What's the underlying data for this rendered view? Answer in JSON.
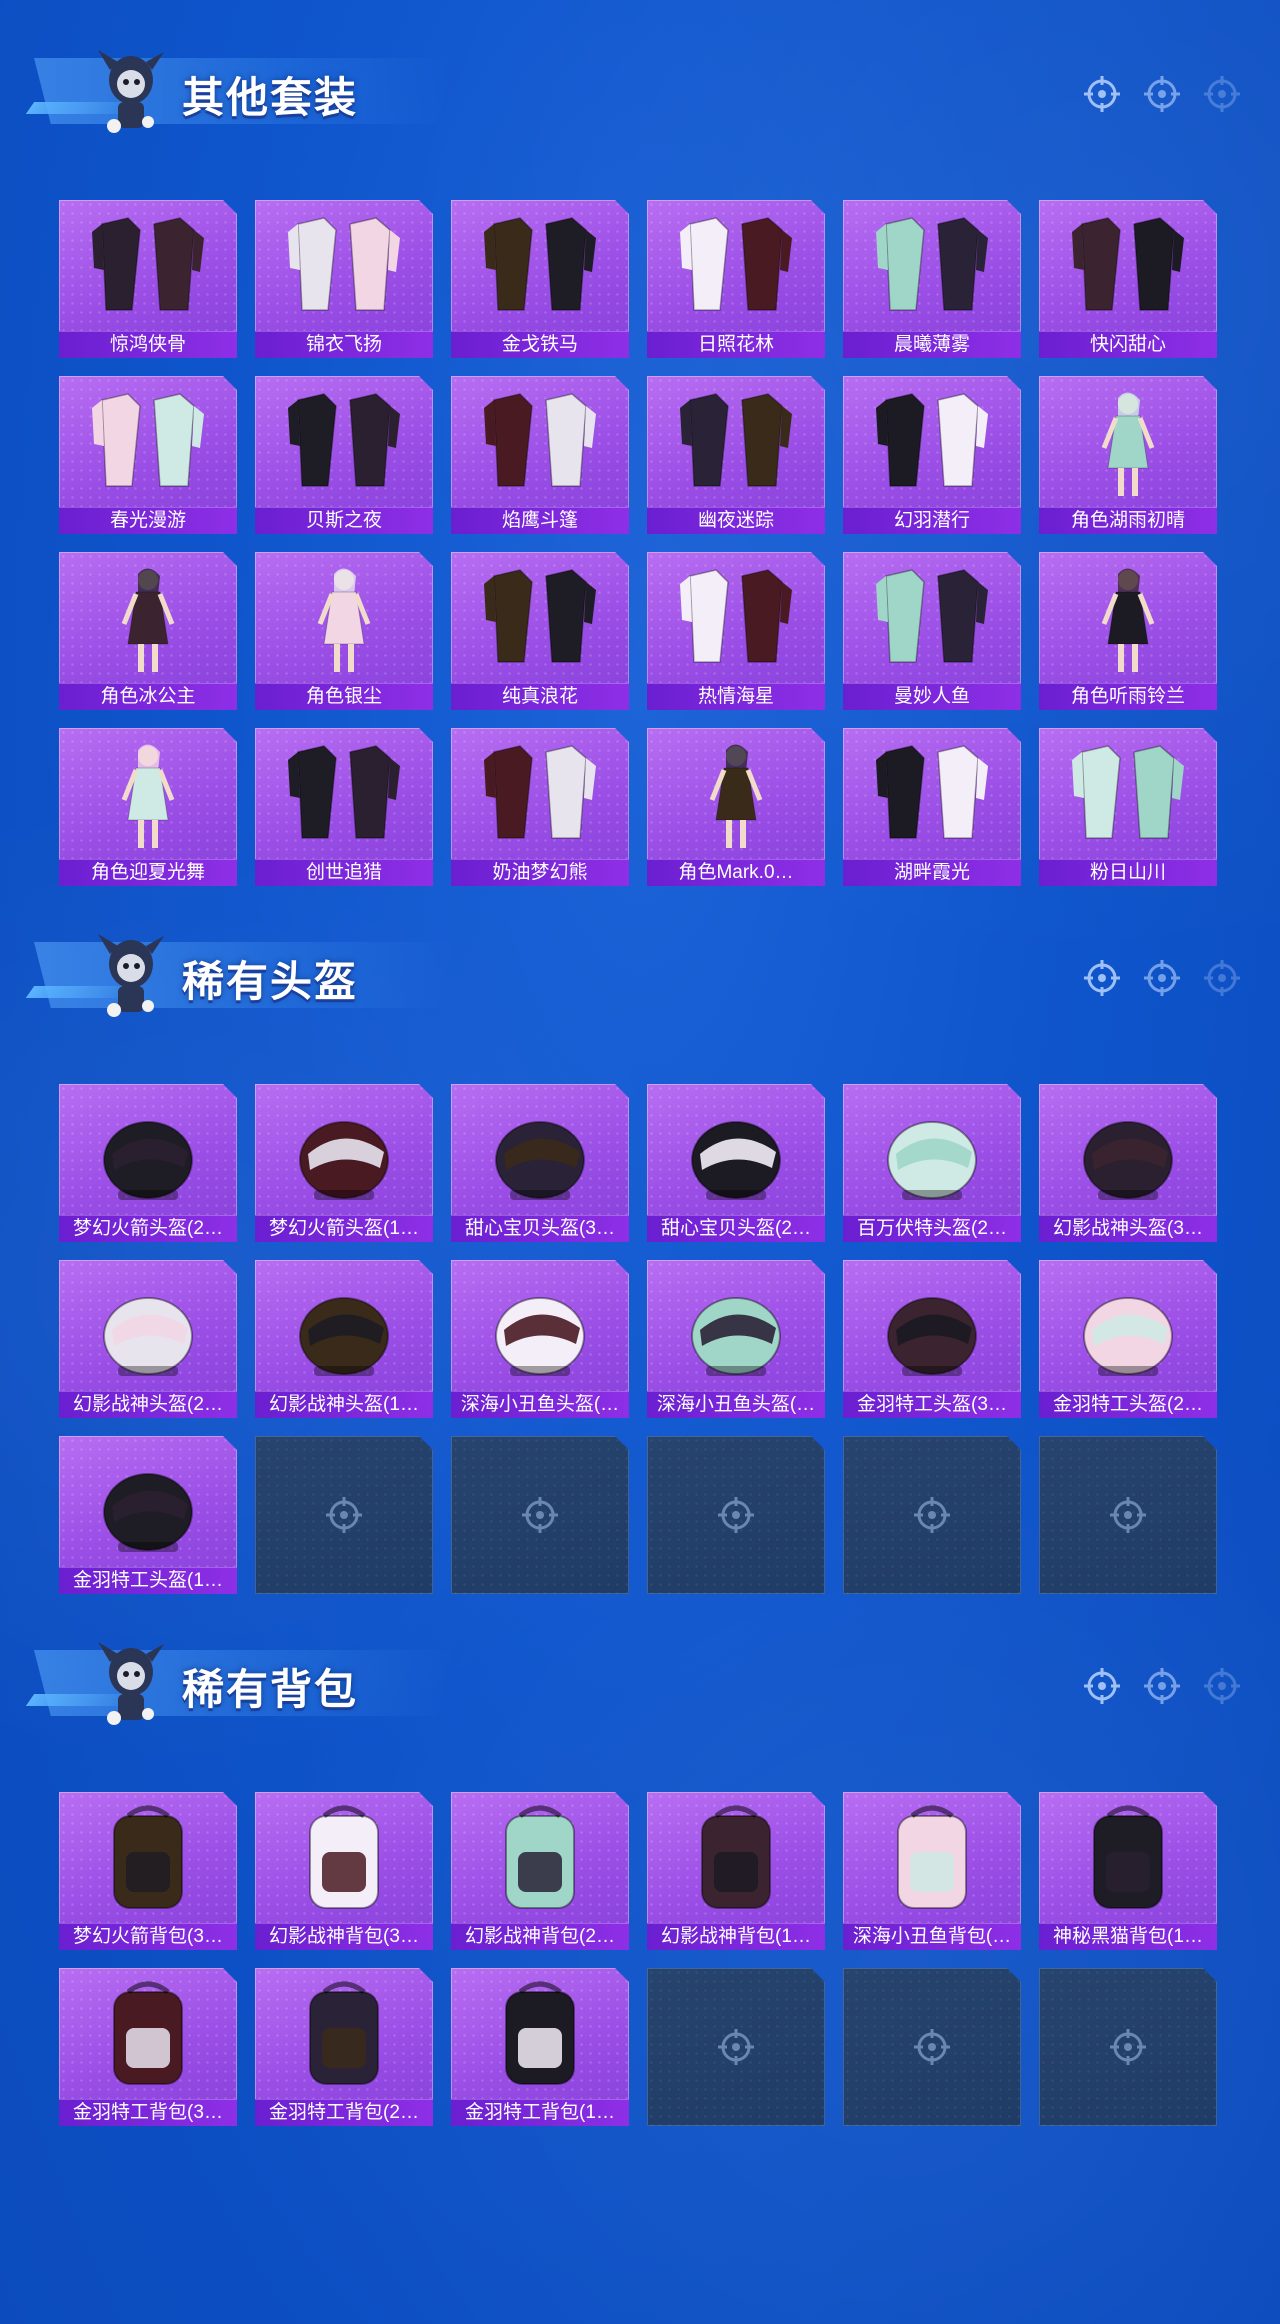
{
  "sections": [
    {
      "title": "其他套装",
      "items": [
        {
          "label": "惊鸿侠骨",
          "art": "outfit"
        },
        {
          "label": "锦衣飞扬",
          "art": "outfit"
        },
        {
          "label": "金戈铁马",
          "art": "outfit"
        },
        {
          "label": "日照花林",
          "art": "outfit"
        },
        {
          "label": "晨曦薄雾",
          "art": "outfit"
        },
        {
          "label": "快闪甜心",
          "art": "outfit"
        },
        {
          "label": "春光漫游",
          "art": "outfit"
        },
        {
          "label": "贝斯之夜",
          "art": "outfit"
        },
        {
          "label": "焰鹰斗篷",
          "art": "outfit"
        },
        {
          "label": "幽夜迷踪",
          "art": "outfit"
        },
        {
          "label": "幻羽潜行",
          "art": "outfit"
        },
        {
          "label": "角色湖雨初晴",
          "art": "character"
        },
        {
          "label": "角色冰公主",
          "art": "character"
        },
        {
          "label": "角色银尘",
          "art": "character"
        },
        {
          "label": "纯真浪花",
          "art": "outfit"
        },
        {
          "label": "热情海星",
          "art": "outfit"
        },
        {
          "label": "曼妙人鱼",
          "art": "outfit"
        },
        {
          "label": "角色听雨铃兰",
          "art": "character"
        },
        {
          "label": "角色迎夏光舞",
          "art": "character"
        },
        {
          "label": "创世追猎",
          "art": "outfit"
        },
        {
          "label": "奶油梦幻熊",
          "art": "outfit"
        },
        {
          "label": "角色Mark.0…",
          "art": "character"
        },
        {
          "label": "湖畔霞光",
          "art": "outfit"
        },
        {
          "label": "粉日山川",
          "art": "outfit"
        }
      ],
      "empty_slots": 0
    },
    {
      "title": "稀有头盔",
      "items": [
        {
          "label": "梦幻火箭头盔(2…",
          "art": "helmet"
        },
        {
          "label": "梦幻火箭头盔(1…",
          "art": "helmet"
        },
        {
          "label": "甜心宝贝头盔(3…",
          "art": "helmet"
        },
        {
          "label": "甜心宝贝头盔(2…",
          "art": "helmet"
        },
        {
          "label": "百万伏特头盔(2…",
          "art": "helmet"
        },
        {
          "label": "幻影战神头盔(3…",
          "art": "helmet"
        },
        {
          "label": "幻影战神头盔(2…",
          "art": "helmet"
        },
        {
          "label": "幻影战神头盔(1…",
          "art": "helmet"
        },
        {
          "label": "深海小丑鱼头盔(…",
          "art": "helmet"
        },
        {
          "label": "深海小丑鱼头盔(…",
          "art": "helmet"
        },
        {
          "label": "金羽特工头盔(3…",
          "art": "helmet"
        },
        {
          "label": "金羽特工头盔(2…",
          "art": "helmet"
        },
        {
          "label": "金羽特工头盔(1…",
          "art": "helmet"
        }
      ],
      "empty_slots": 5
    },
    {
      "title": "稀有背包",
      "items": [
        {
          "label": "梦幻火箭背包(3…",
          "art": "backpack"
        },
        {
          "label": "幻影战神背包(3…",
          "art": "backpack"
        },
        {
          "label": "幻影战神背包(2…",
          "art": "backpack"
        },
        {
          "label": "幻影战神背包(1…",
          "art": "backpack"
        },
        {
          "label": "深海小丑鱼背包(…",
          "art": "backpack"
        },
        {
          "label": "神秘黑猫背包(1…",
          "art": "backpack"
        },
        {
          "label": "金羽特工背包(3…",
          "art": "backpack"
        },
        {
          "label": "金羽特工背包(2…",
          "art": "backpack"
        },
        {
          "label": "金羽特工背包(1…",
          "art": "backpack"
        }
      ],
      "empty_slots": 3
    }
  ],
  "icons": {
    "header_decoration": [
      "target-icon",
      "target-icon",
      "target-icon"
    ],
    "empty_slot": "target-icon"
  },
  "colors": {
    "background": "#0f55cc",
    "card": "#9a4ee6",
    "label_bar": "#7a26dc",
    "empty_card": "#223f6a"
  }
}
